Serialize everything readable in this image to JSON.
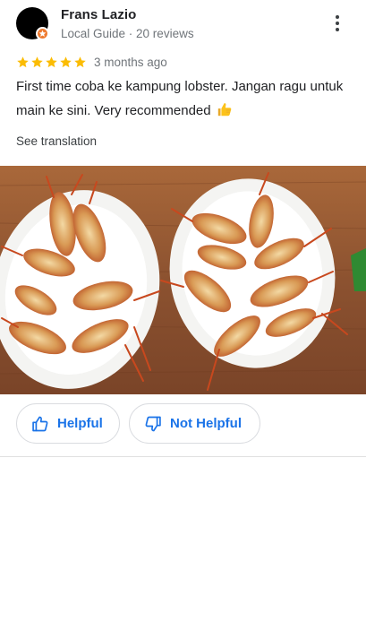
{
  "reviewer": {
    "name": "Frans Lazio",
    "meta": "Local Guide · 20 reviews"
  },
  "review": {
    "rating": 5,
    "rating_max": 5,
    "time": "3 months ago",
    "text": "First time coba ke kampung lobster. Jangan ragu untuk main ke sini. Very recommended",
    "see_translation": "See translation"
  },
  "actions": {
    "helpful_label": "Helpful",
    "not_helpful_label": "Not Helpful"
  },
  "icons": {
    "more": "more-vert-icon",
    "star": "star-icon",
    "thumb_emoji": "thumbs-up-emoji-icon",
    "helpful": "thumb-up-outline-icon",
    "not_helpful": "thumb-down-outline-icon",
    "local_guide_badge": "local-guide-badge-icon"
  },
  "colors": {
    "star": "#fbbc04",
    "accent": "#1a73e8",
    "local_guide_badge": "#ee7b30",
    "muted_text": "#70757a"
  }
}
